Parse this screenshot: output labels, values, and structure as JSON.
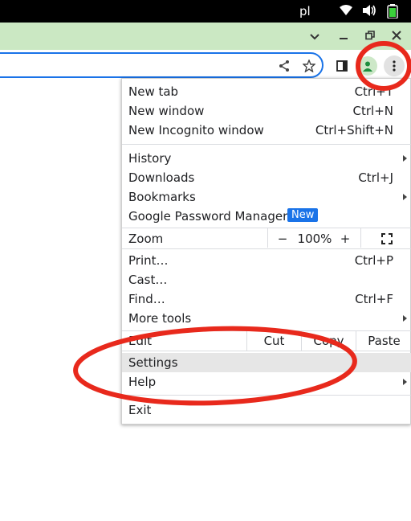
{
  "os_bar": {
    "language": "pl",
    "icons": [
      "wifi-icon",
      "volume-icon",
      "battery-icon"
    ]
  },
  "window_controls": {
    "icons": [
      "tab-search-icon",
      "minimize-icon",
      "restore-icon",
      "close-icon"
    ]
  },
  "toolbar": {
    "icons": [
      "share-icon",
      "bookmark-star-icon",
      "side-panel-icon",
      "profile-icon",
      "more-menu-icon"
    ]
  },
  "menu": {
    "new_tab": {
      "label": "New tab",
      "shortcut": "Ctrl+T"
    },
    "new_window": {
      "label": "New window",
      "shortcut": "Ctrl+N"
    },
    "new_incognito": {
      "label": "New Incognito window",
      "shortcut": "Ctrl+Shift+N"
    },
    "history": {
      "label": "History"
    },
    "downloads": {
      "label": "Downloads",
      "shortcut": "Ctrl+J"
    },
    "bookmarks": {
      "label": "Bookmarks"
    },
    "password_manager": {
      "label": "Google Password Manager",
      "badge": "New"
    },
    "zoom": {
      "label": "Zoom",
      "minus": "−",
      "value": "100%",
      "plus": "+"
    },
    "print": {
      "label": "Print…",
      "shortcut": "Ctrl+P"
    },
    "cast": {
      "label": "Cast…"
    },
    "find": {
      "label": "Find…",
      "shortcut": "Ctrl+F"
    },
    "more_tools": {
      "label": "More tools"
    },
    "edit": {
      "label": "Edit",
      "cut": "Cut",
      "copy": "Copy",
      "paste": "Paste"
    },
    "settings": {
      "label": "Settings"
    },
    "help": {
      "label": "Help"
    },
    "exit": {
      "label": "Exit"
    }
  },
  "colors": {
    "tab_strip": "#cbe8c3",
    "accent": "#1a73e8",
    "annotation": "#e8291c"
  }
}
